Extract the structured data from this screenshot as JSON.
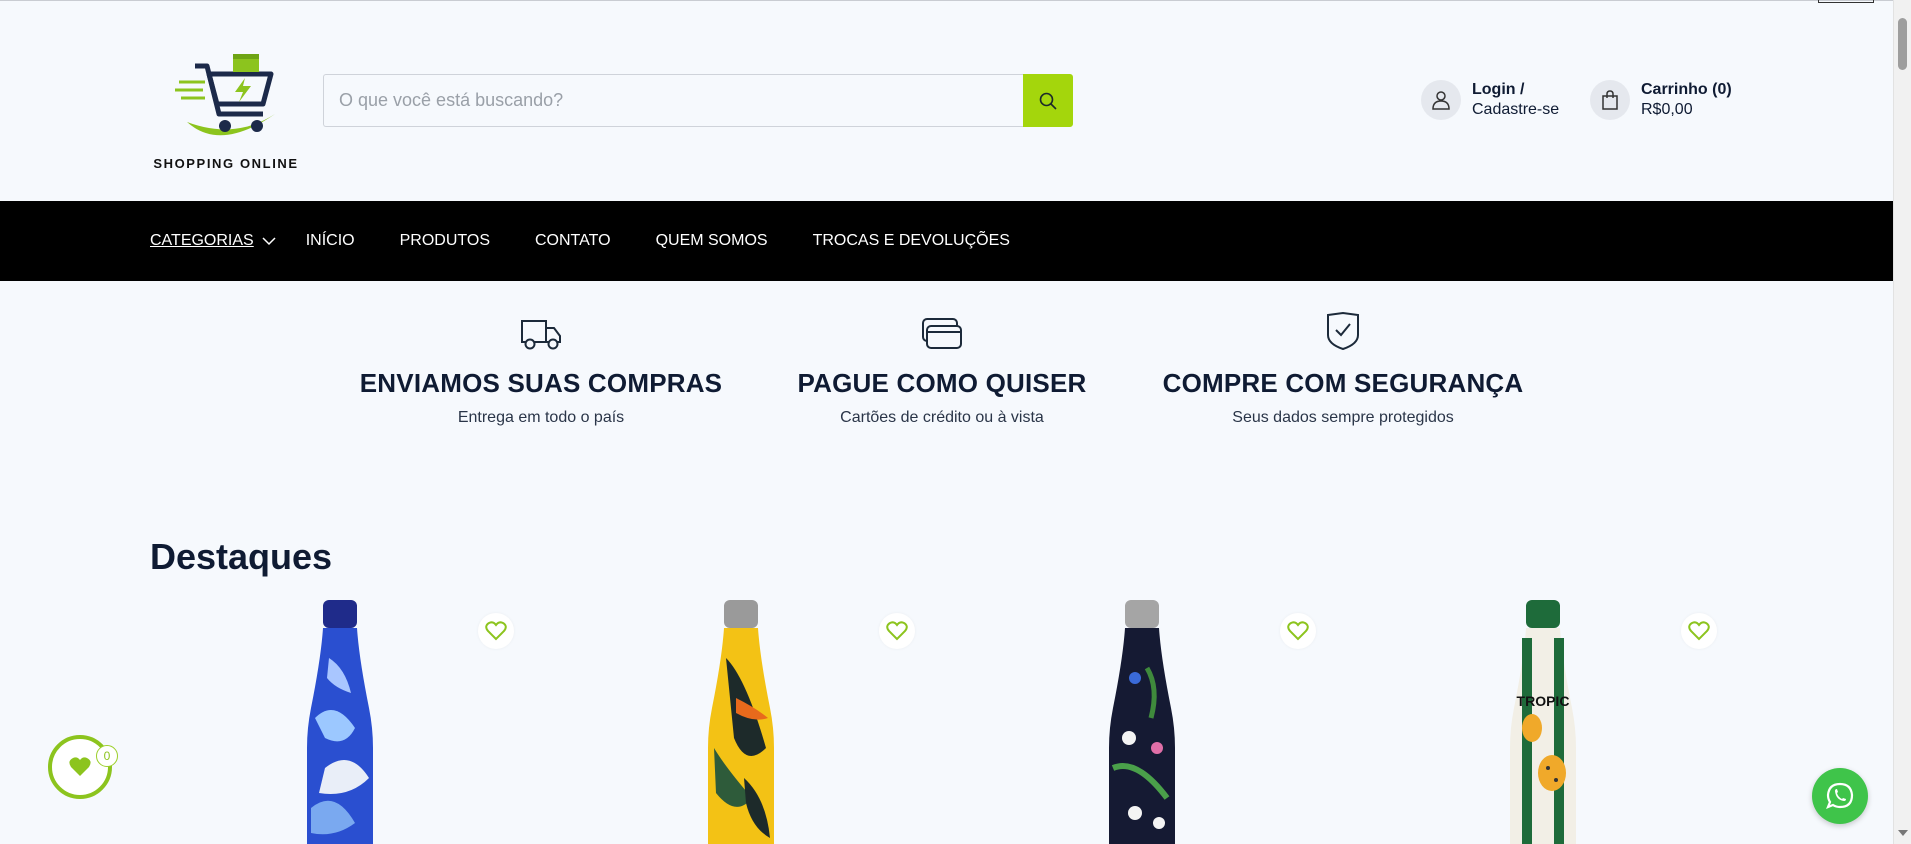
{
  "header": {
    "logo_text": "SHOPPING ONLINE",
    "search": {
      "placeholder": "O que você está buscando?",
      "value": ""
    },
    "account": {
      "line1": "Login /",
      "line2": "Cadastre-se"
    },
    "cart": {
      "line1": "Carrinho (0)",
      "line2": "R$0,00"
    }
  },
  "nav": {
    "items": [
      {
        "label": "CATEGORIAS"
      },
      {
        "label": "INÍCIO"
      },
      {
        "label": "PRODUTOS"
      },
      {
        "label": "CONTATO"
      },
      {
        "label": "QUEM SOMOS"
      },
      {
        "label": "TROCAS E DEVOLUÇÕES"
      }
    ]
  },
  "features": [
    {
      "icon": "truck-icon",
      "title": "ENVIAMOS SUAS COMPRAS",
      "subtitle": "Entrega em todo o país"
    },
    {
      "icon": "credit-card-icon",
      "title": "PAGUE COMO QUISER",
      "subtitle": "Cartões de crédito ou à vista"
    },
    {
      "icon": "shield-check-icon",
      "title": "COMPRE COM SEGURANÇA",
      "subtitle": "Seus dados sempre protegidos"
    }
  ],
  "highlights": {
    "title": "Destaques",
    "products": [
      {
        "image": "bottle-blue-birds"
      },
      {
        "image": "bottle-yellow-toucan"
      },
      {
        "image": "bottle-dark-tropical-flowers"
      },
      {
        "image": "bottle-green-stripes-tropic",
        "bottle_text": "TROPIC"
      }
    ]
  },
  "wishlist": {
    "count": "0"
  },
  "colors": {
    "accent": "#a4d60c",
    "nav_bg": "#000000",
    "whatsapp": "#3fc44a",
    "text_dark": "#0f1b33"
  }
}
